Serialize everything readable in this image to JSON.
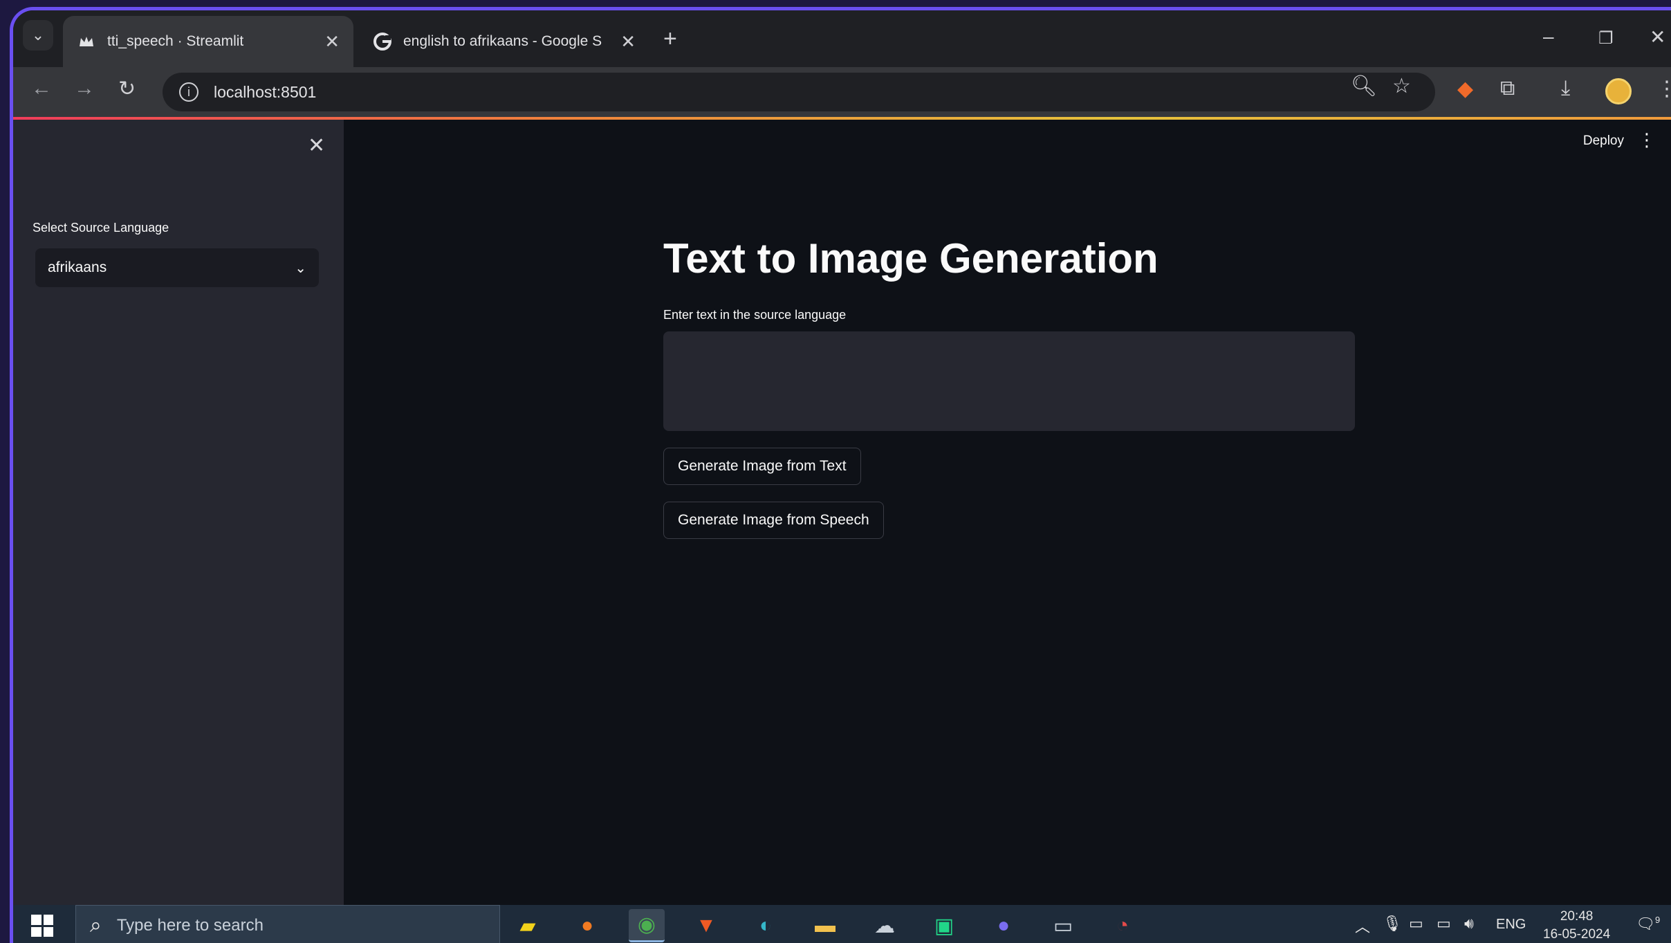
{
  "browser": {
    "tabs": [
      {
        "title": "tti_speech · Streamlit",
        "favicon": "streamlit-crown-icon",
        "active": true
      },
      {
        "title": "english to afrikaans - Google S",
        "favicon": "google-g-icon",
        "active": false
      }
    ],
    "url": "localhost:8501"
  },
  "app": {
    "deploy_label": "Deploy",
    "sidebar": {
      "select_label": "Select Source Language",
      "selected_language": "afrikaans"
    },
    "title": "Text to Image Generation",
    "text_input_label": "Enter text in the source language",
    "text_input_value": "",
    "buttons": {
      "from_text": "Generate Image from Text",
      "from_speech": "Generate Image from Speech"
    }
  },
  "taskbar": {
    "search_placeholder": "Type here to search",
    "language": "ENG",
    "time": "20:48",
    "date": "16-05-2024",
    "notification_count": "9"
  },
  "colors": {
    "frame_border": "#6a4ff0",
    "app_bg": "#0e1117",
    "sidebar_bg": "#262730",
    "accent_line": "#f03c5a"
  }
}
